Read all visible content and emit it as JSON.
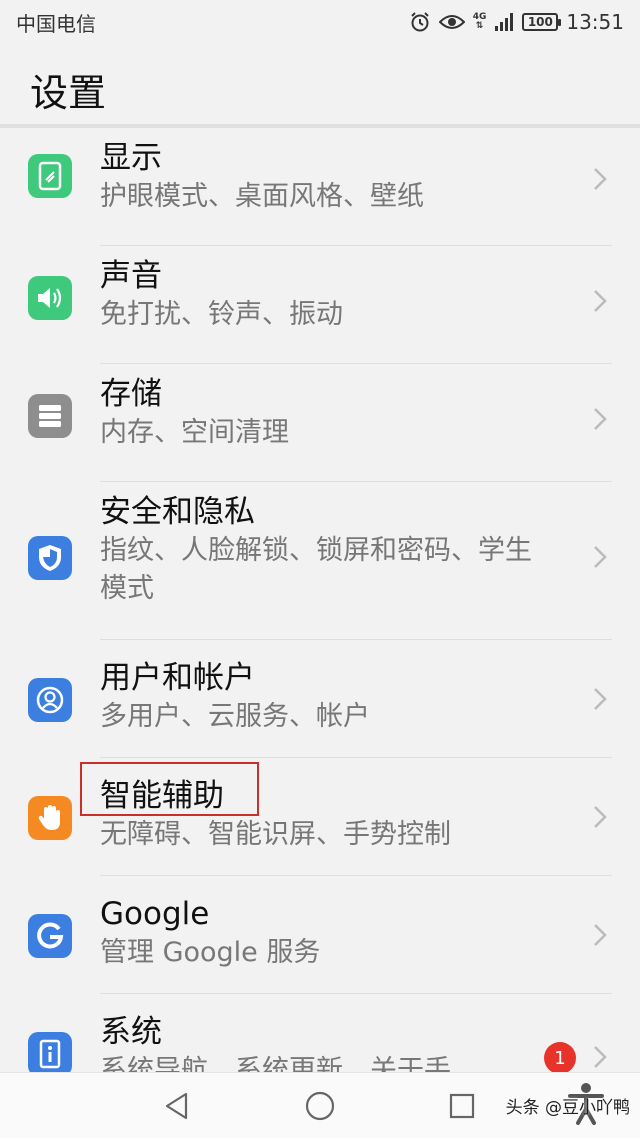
{
  "status_bar": {
    "carrier": "中国电信",
    "net_type": "4G",
    "battery": "100",
    "time": "13:51"
  },
  "page": {
    "title": "设置"
  },
  "items": [
    {
      "title": "显示",
      "subtitle": "护眼模式、桌面风格、壁纸",
      "icon": "display-icon",
      "color": "#3ec97c"
    },
    {
      "title": "声音",
      "subtitle": "免打扰、铃声、振动",
      "icon": "speaker-icon",
      "color": "#3ec97c"
    },
    {
      "title": "存储",
      "subtitle": "内存、空间清理",
      "icon": "storage-icon",
      "color": "#8e8e8e"
    },
    {
      "title": "安全和隐私",
      "subtitle": "指纹、人脸解锁、锁屏和密码、学生",
      "subtitle2": "模式",
      "icon": "shield-icon",
      "color": "#3d7fe0"
    },
    {
      "title": "用户和帐户",
      "subtitle": "多用户、云服务、帐户",
      "icon": "user-icon",
      "color": "#3d7fe0"
    },
    {
      "title": "智能辅助",
      "subtitle": "无障碍、智能识屏、手势控制",
      "icon": "hand-icon",
      "color": "#f58a23"
    },
    {
      "title": "Google",
      "subtitle": "管理 Google 服务",
      "icon": "google-icon",
      "color": "#3d7fe0"
    },
    {
      "title": "系统",
      "subtitle": "系统导航、系统更新、关于手",
      "icon": "system-icon",
      "color": "#3d7fe0",
      "badge": "1"
    }
  ],
  "nav": {
    "back": "back-icon",
    "home": "home-icon",
    "recents": "recents-icon"
  },
  "watermark": "头条 @豆小吖鸭"
}
